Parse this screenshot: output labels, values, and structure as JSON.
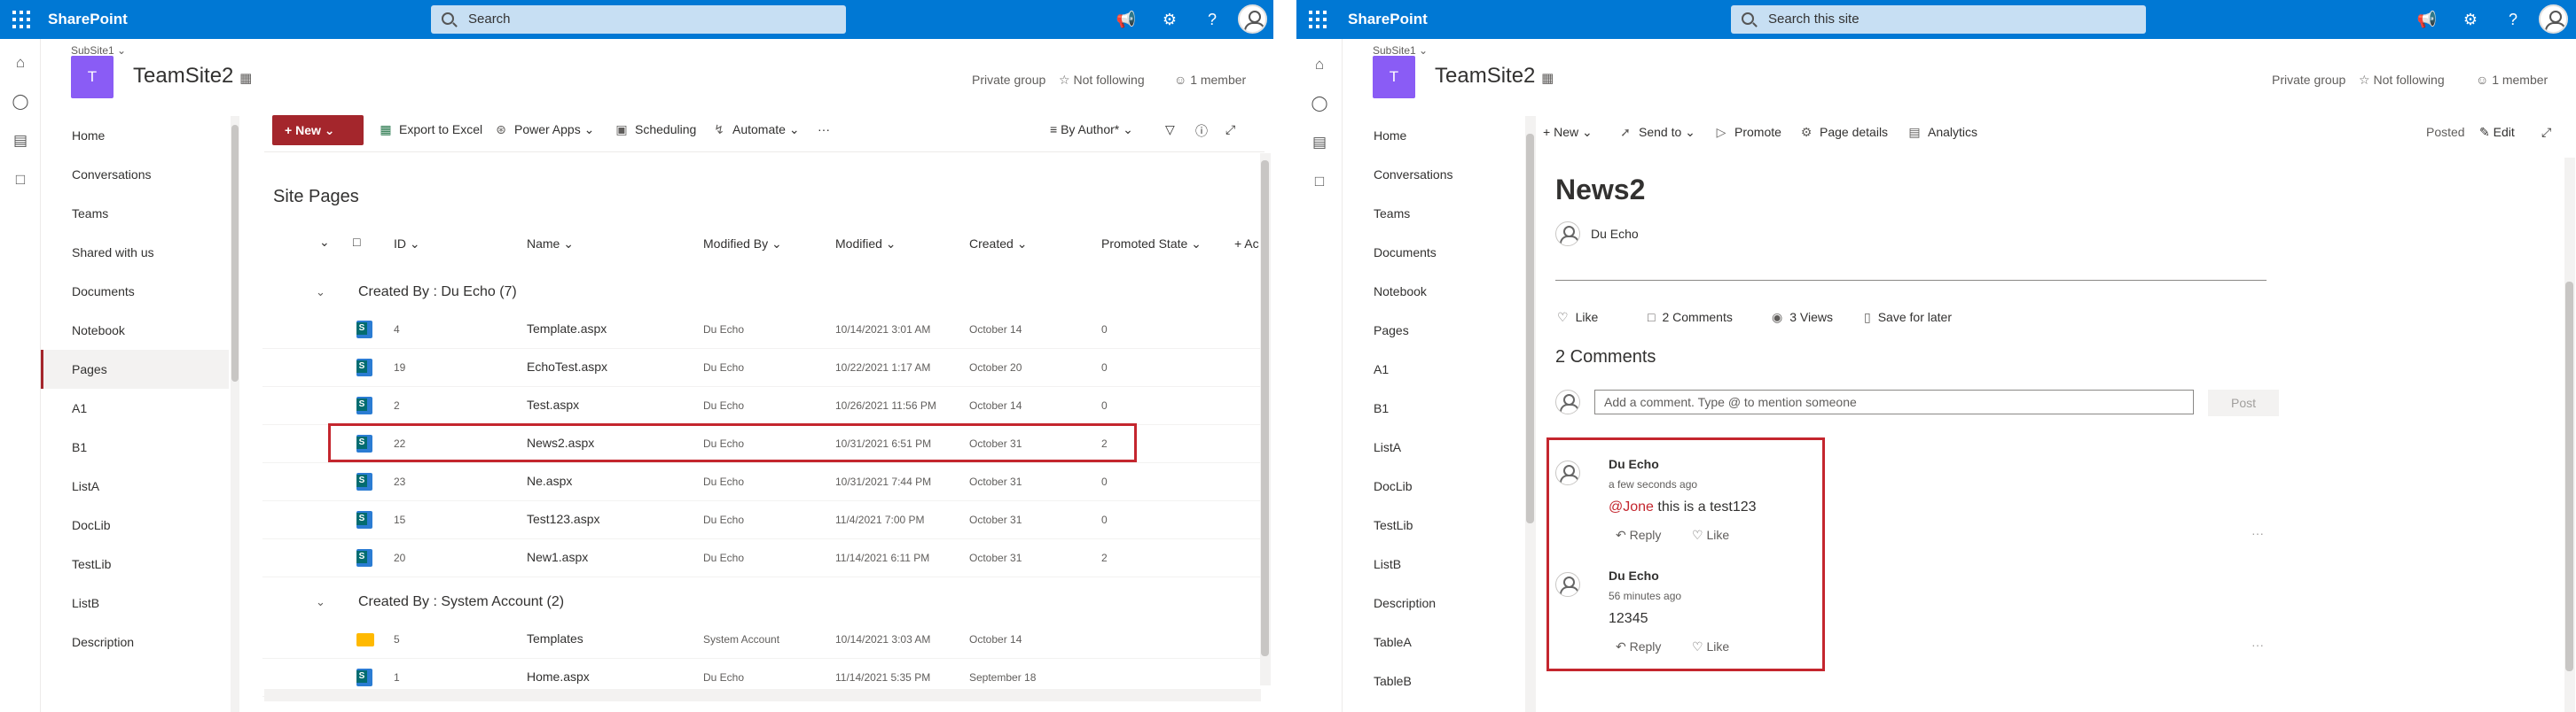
{
  "left": {
    "suite": {
      "brand": "SharePoint",
      "search_placeholder": "Search"
    },
    "site": {
      "subsite": "SubSite1",
      "title": "TeamSite2",
      "privacy": "Private group",
      "follow": "Not following",
      "members": "1 member"
    },
    "nav": [
      "Home",
      "Conversations",
      "Teams",
      "Shared with us",
      "Documents",
      "Notebook",
      "Pages",
      "A1",
      "B1",
      "ListA",
      "DocLib",
      "TestLib",
      "ListB",
      "Description"
    ],
    "selected_nav": "Pages",
    "commands": {
      "new": "New",
      "export": "Export to Excel",
      "powerapps": "Power Apps",
      "scheduling": "Scheduling",
      "automate": "Automate",
      "more": "···",
      "view": "By Author*"
    },
    "page_title": "Site Pages",
    "columns": {
      "id": "ID",
      "name": "Name",
      "modified_by": "Modified By",
      "modified": "Modified",
      "created": "Created",
      "promoted": "Promoted State",
      "add": "+ Ac"
    },
    "groups": [
      {
        "label": "Created By : Du Echo (7)",
        "rows": [
          {
            "id": "4",
            "name": "Template.aspx",
            "by": "Du Echo",
            "modified": "10/14/2021 3:01 AM",
            "created": "October 14",
            "state": "0"
          },
          {
            "id": "19",
            "name": "EchoTest.aspx",
            "by": "Du Echo",
            "modified": "10/22/2021 1:17 AM",
            "created": "October 20",
            "state": "0"
          },
          {
            "id": "2",
            "name": "Test.aspx",
            "by": "Du Echo",
            "modified": "10/26/2021 11:56 PM",
            "created": "October 14",
            "state": "0"
          },
          {
            "id": "22",
            "name": "News2.aspx",
            "by": "Du Echo",
            "modified": "10/31/2021 6:51 PM",
            "created": "October 31",
            "state": "2"
          },
          {
            "id": "23",
            "name": "Ne.aspx",
            "by": "Du Echo",
            "modified": "10/31/2021 7:44 PM",
            "created": "October 31",
            "state": "0"
          },
          {
            "id": "15",
            "name": "Test123.aspx",
            "by": "Du Echo",
            "modified": "11/4/2021 7:00 PM",
            "created": "October 31",
            "state": "0"
          },
          {
            "id": "20",
            "name": "New1.aspx",
            "by": "Du Echo",
            "modified": "11/14/2021 6:11 PM",
            "created": "October 31",
            "state": "2"
          }
        ]
      },
      {
        "label": "Created By : System Account (2)",
        "rows": [
          {
            "id": "5",
            "name": "Templates",
            "by": "System Account",
            "modified": "10/14/2021 3:03 AM",
            "created": "October 14",
            "state": ""
          },
          {
            "id": "1",
            "name": "Home.aspx",
            "by": "Du Echo",
            "modified": "11/14/2021 5:35 PM",
            "created": "September 18",
            "state": ""
          }
        ]
      }
    ]
  },
  "right": {
    "suite": {
      "brand": "SharePoint",
      "search_placeholder": "Search this site"
    },
    "site": {
      "subsite": "SubSite1",
      "title": "TeamSite2",
      "privacy": "Private group",
      "follow": "Not following",
      "members": "1 member"
    },
    "nav": [
      "Home",
      "Conversations",
      "Teams",
      "Documents",
      "Notebook",
      "Pages",
      "A1",
      "B1",
      "ListA",
      "DocLib",
      "TestLib",
      "ListB",
      "Description",
      "TableA",
      "TableB"
    ],
    "commands": {
      "new": "New",
      "send": "Send to",
      "promote": "Promote",
      "details": "Page details",
      "analytics": "Analytics",
      "status": "Posted",
      "edit": "Edit"
    },
    "news_title": "News2",
    "author": "Du Echo",
    "social": {
      "like": "Like",
      "comments": "2 Comments",
      "views": "3 Views",
      "save": "Save for later"
    },
    "comments_heading": "2 Comments",
    "comment_placeholder": "Add a comment. Type @ to mention someone",
    "post": "Post",
    "comments": [
      {
        "author": "Du Echo",
        "time": "a few seconds ago",
        "mention": "@Jone",
        "text": " this is a test123",
        "reply": "Reply",
        "like": "Like",
        "more": "···"
      },
      {
        "author": "Du Echo",
        "time": "56 minutes ago",
        "mention": "",
        "text": "12345",
        "reply": "Reply",
        "like": "Like",
        "more": "···"
      }
    ]
  },
  "colors": {
    "suite_blue": "#0078d4",
    "accent_red": "#a4262c",
    "highlight_red": "#c4262e",
    "logo_purple": "#8a5cf5"
  },
  "icons": [
    "waffle-icon",
    "search-icon",
    "megaphone-icon",
    "settings-icon",
    "help-icon",
    "home-icon",
    "globe-icon",
    "news-icon",
    "page-icon",
    "excel-icon",
    "powerapps-icon",
    "scheduling-icon",
    "automate-icon",
    "filter-icon",
    "info-icon",
    "expand-icon",
    "like-icon",
    "comment-icon",
    "views-icon",
    "bookmark-icon",
    "reply-icon"
  ]
}
